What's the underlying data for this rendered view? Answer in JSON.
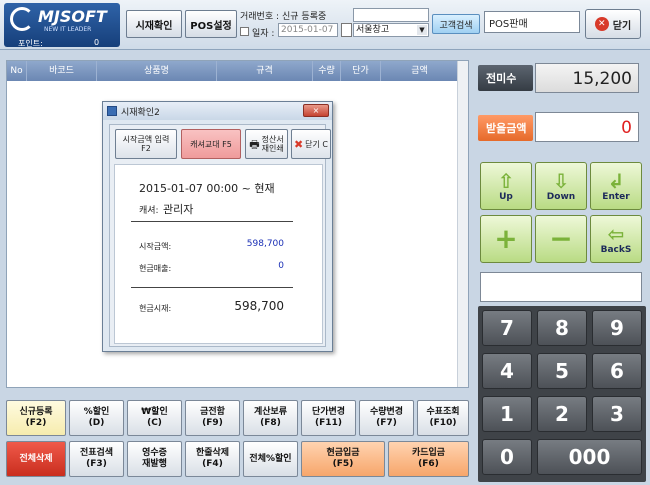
{
  "header": {
    "logo_text": "MJSOFT",
    "logo_sub": "NEW IT LEADER",
    "point_label": "포인트:",
    "point_value": "0",
    "sale_confirm": "시재확인",
    "pos_settings": "POS설정",
    "trade_label": "거래번호 :",
    "trade_value": "신규 등록중",
    "date_label": "일자 :",
    "date_value": "2015-01-07",
    "warehouse": "서울창고",
    "customer_search": "고객검색",
    "mode": "POS판매",
    "close": "닫기"
  },
  "grid": {
    "columns": [
      "No",
      "바코드",
      "상품명",
      "규격",
      "수량",
      "단가",
      "금액"
    ]
  },
  "dialog": {
    "title": "시재확인2",
    "close": "×",
    "btn_start_amount": "시작금액 입력",
    "btn_start_key": "F2",
    "btn_cashier_change": "캐셔교대 F5",
    "btn_print_1": "정산서",
    "btn_print_2": "재인쇄",
    "btn_close": "닫기 C",
    "period": "2015-01-07 00:00 ~ 현재",
    "cashier_label": "캐셔:",
    "cashier_value": "관리자",
    "start_amount_label": "시작금액:",
    "start_amount_value": "598,700",
    "cash_sales_label": "현금매출:",
    "cash_sales_value": "0",
    "cash_time_label": "현금시재:",
    "cash_time_value": "598,700"
  },
  "functions": {
    "row1": [
      {
        "l1": "신규등록",
        "l2": "(F2)",
        "style": "yellow"
      },
      {
        "l1": "%할인",
        "l2": "(D)",
        "style": ""
      },
      {
        "l1": "₩할인",
        "l2": "(C)",
        "style": ""
      },
      {
        "l1": "금전함",
        "l2": "(F9)",
        "style": ""
      },
      {
        "l1": "계산보류",
        "l2": "(F8)",
        "style": ""
      },
      {
        "l1": "단가변경",
        "l2": "(F11)",
        "style": ""
      },
      {
        "l1": "수량변경",
        "l2": "(F7)",
        "style": ""
      },
      {
        "l1": "수표조회",
        "l2": "(F10)",
        "style": ""
      }
    ],
    "row2": [
      {
        "l1": "전체삭제",
        "l2": "",
        "style": "red"
      },
      {
        "l1": "전표검색",
        "l2": "(F3)",
        "style": ""
      },
      {
        "l1": "영수증",
        "l2": "재발행",
        "style": ""
      },
      {
        "l1": "한줄삭제",
        "l2": "(F4)",
        "style": ""
      },
      {
        "l1": "전체%할인",
        "l2": "",
        "style": ""
      },
      {
        "l1": "현금입금",
        "l2": "(F5)",
        "style": "orange"
      },
      {
        "l1": "카드입금",
        "l2": "(F6)",
        "style": "orange"
      }
    ]
  },
  "right": {
    "unpaid_label": "전미수",
    "unpaid_value": "15,200",
    "receive_label": "받을금액",
    "receive_value": "0",
    "nav": [
      {
        "glyph": "⇧",
        "label": "Up"
      },
      {
        "glyph": "⇩",
        "label": "Down"
      },
      {
        "glyph": "↲",
        "label": "Enter"
      },
      {
        "glyph": "+",
        "label": ""
      },
      {
        "glyph": "−",
        "label": ""
      },
      {
        "glyph": "⇦",
        "label": "BackS"
      }
    ],
    "keys": [
      "7",
      "8",
      "9",
      "4",
      "5",
      "6",
      "1",
      "2",
      "3",
      "0",
      "000"
    ]
  }
}
